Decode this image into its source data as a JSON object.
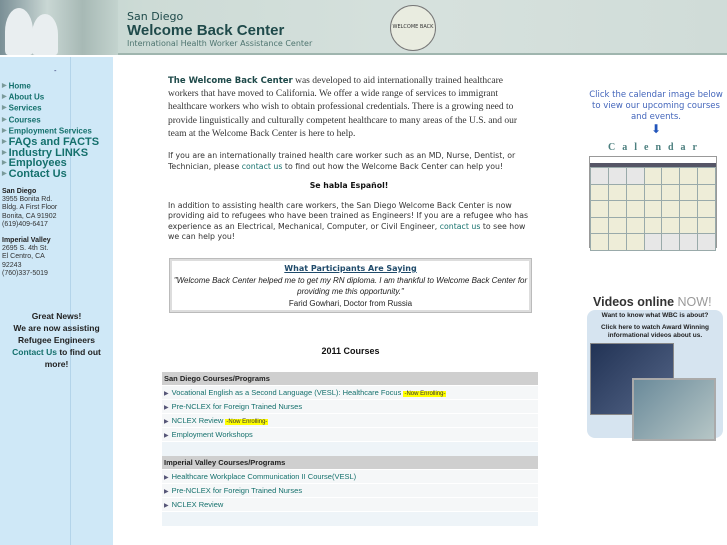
{
  "header": {
    "line1": "San Diego",
    "line2": "Welcome Back Center",
    "line3": "International Health Worker Assistance Center",
    "seal_text": "WELCOME BACK"
  },
  "sidebar": {
    "dot": "-",
    "items": [
      {
        "label": "Home",
        "size": "small"
      },
      {
        "label": "About Us",
        "size": "small"
      },
      {
        "label": "Services",
        "size": "small"
      },
      {
        "label": "Courses",
        "size": "small"
      },
      {
        "label": "Employment Services",
        "size": "small"
      },
      {
        "label": "FAQs and FACTS",
        "size": "big"
      },
      {
        "label": "Industry LINKS",
        "size": "big"
      },
      {
        "label": "Employees",
        "size": "big"
      },
      {
        "label": "Contact Us",
        "size": "big"
      }
    ],
    "san_diego": {
      "title": "San Diego",
      "lines": [
        "3955 Bonita Rd.",
        "Bldg. A First Floor",
        "Bonita, CA 91902",
        "(619)409-6417"
      ]
    },
    "imperial_valley": {
      "title": "Imperial Valley",
      "lines": [
        "2695 S. 4th St.",
        "El Centro, CA",
        "92243",
        "(760)337-5019"
      ]
    },
    "news": {
      "l1": "Great News!",
      "l2": "We are now assisting",
      "l3": "Refugee Engineers",
      "link": "Contact Us",
      "l4": " to find out",
      "l5": "more!"
    }
  },
  "main": {
    "intro_bold": "The Welcome Back Center",
    "intro_rest": " was developed to aid internationally trained healthcare workers that have moved to California. We offer a wide range of services to immigrant healthcare workers who wish to obtain professional credentials. There is a growing need to provide linguistically and culturally competent healthcare to many areas of the U.S. and our team at the Welcome Back Center is here to help.",
    "p2_a": "If you are an internationally trained health care worker such as an MD, Nurse, Dentist, or Technician, please ",
    "p2_link": "contact us",
    "p2_b": " to find out how the Welcome Back Center can help you!",
    "espanol": "Se habla Español!",
    "p3_a": "In addition to assisting health care workers, the San Diego Welcome Back Center is now providing aid to refugees who have been trained as Engineers! If you are a refugee who has experience as an Electrical, Mechanical, Computer, or Civil Engineer, ",
    "p3_link": "contact us",
    "p3_b": " to see how we can help you!",
    "testimonial": {
      "title": "What Participants Are Saying",
      "quote": "\"Welcome Back Center helped me to get my RN diploma. I am thankful to Welcome Back Center for providing me this opportunity.\"",
      "author": "Farid Gowhari, Doctor from Russia"
    },
    "courses_title": "2011 Courses",
    "san_diego_programs": {
      "header": "San Diego Courses/Programs",
      "items": [
        {
          "label": "Vocational English as a Second Language (VESL): Healthcare Focus",
          "badge": "-Now Enrolling-"
        },
        {
          "label": "Pre-NCLEX for Foreign Trained Nurses"
        },
        {
          "label": "NCLEX Review",
          "badge": "-Now Enrolling-"
        },
        {
          "label": "Employment Workshops"
        }
      ]
    },
    "imperial_programs": {
      "header": "Imperial Valley Courses/Programs",
      "items": [
        {
          "label": "Healthcare Workplace Communication II Course(VESL)"
        },
        {
          "label": "Pre-NCLEX for Foreign Trained Nurses"
        },
        {
          "label": "NCLEX Review"
        }
      ]
    }
  },
  "right": {
    "cal_text": "Click the calendar image below to view our upcoming courses and events.",
    "cal_arrow": "⬇",
    "cal_word": "Calendar",
    "videos_title": "Videos online",
    "videos_now": "NOW!",
    "videos_q": "Want to know what WBC is about?",
    "videos_cta": "Click here to watch Award Winning informational videos about us."
  }
}
